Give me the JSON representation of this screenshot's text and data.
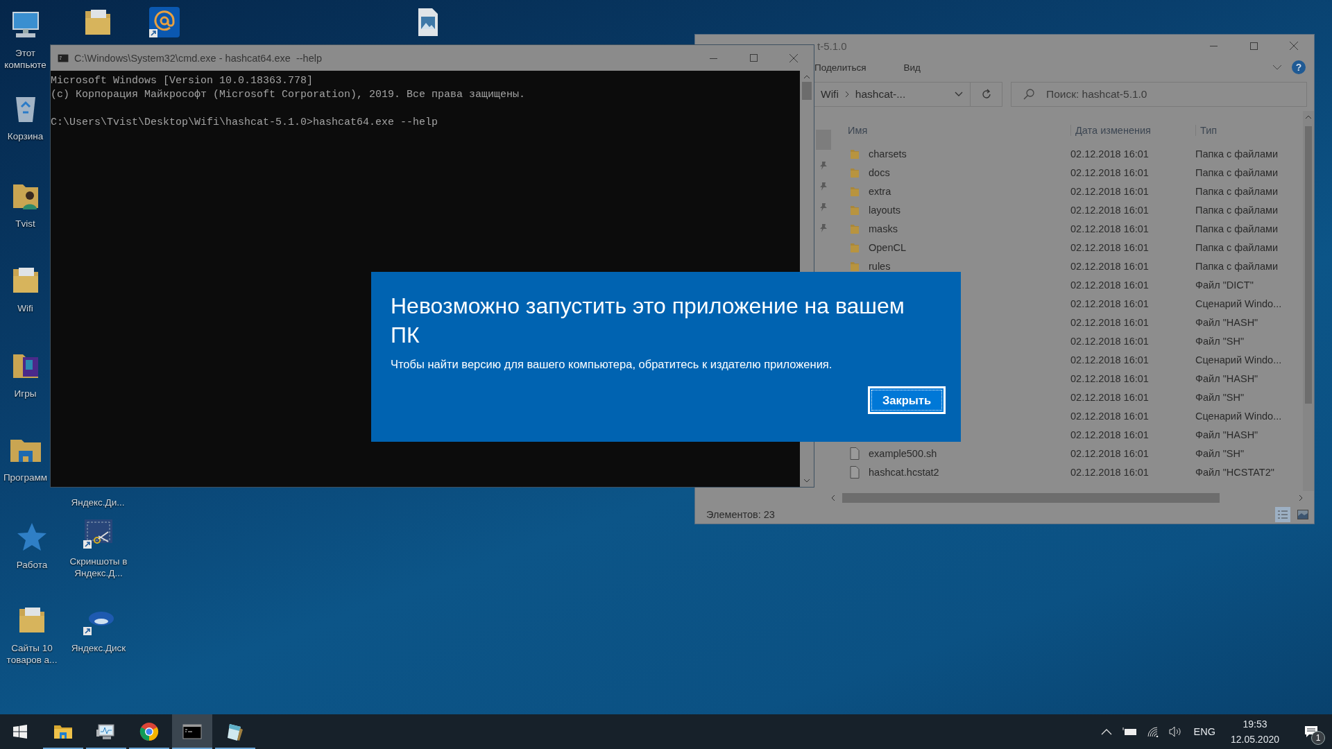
{
  "desktop_icons": [
    {
      "label": "Этот компьюте",
      "kind": "computer"
    },
    {
      "label": "Корзина",
      "kind": "recycle-bin"
    },
    {
      "label": "Tvist",
      "kind": "user-folder"
    },
    {
      "label": "Wifi",
      "kind": "folder"
    },
    {
      "label": "Игры",
      "kind": "games"
    },
    {
      "label": "Программ",
      "kind": "programs"
    },
    {
      "label": "Работа",
      "kind": "star"
    },
    {
      "label": "Сайты 10 товаров а...",
      "kind": "folder"
    },
    {
      "kind": "folder"
    },
    {
      "label": "Яндекс.Ди..."
    },
    {
      "label": "Скриншоты в Яндекс.Д...",
      "kind": "screenshots"
    },
    {
      "label": "Яндекс.Диск",
      "kind": "disk"
    },
    {
      "kind": "mail"
    },
    {
      "kind": "image"
    }
  ],
  "cmd_window": {
    "title": "C:\\Windows\\System32\\cmd.exe - hashcat64.exe  --help",
    "banner": [
      "Microsoft Windows [Version 10.0.18363.778]",
      "(c) Корпорация Майкрософт (Microsoft Corporation), 2019. Все права защищены."
    ],
    "prompt": "C:\\Users\\Tvist\\Desktop\\Wifi\\hashcat-5.1.0>hashcat64.exe --help"
  },
  "explorer": {
    "title": "t-5.1.0",
    "ribbon_tabs": [
      "Поделиться",
      "Вид"
    ],
    "help_button": "?",
    "breadcrumb": [
      "Wifi",
      "hashcat-..."
    ],
    "search": {
      "placeholder": "Поиск: hashcat-5.1.0"
    },
    "columns": [
      "Имя",
      "Дата изменения",
      "Тип"
    ],
    "rows": [
      {
        "name": "charsets",
        "kind": "folder",
        "date": "02.12.2018 16:01",
        "type": "Папка с файлами"
      },
      {
        "name": "docs",
        "kind": "folder",
        "date": "02.12.2018 16:01",
        "type": "Папка с файлами"
      },
      {
        "name": "extra",
        "kind": "folder",
        "date": "02.12.2018 16:01",
        "type": "Папка с файлами"
      },
      {
        "name": "layouts",
        "kind": "folder",
        "date": "02.12.2018 16:01",
        "type": "Папка с файлами"
      },
      {
        "name": "masks",
        "kind": "folder",
        "date": "02.12.2018 16:01",
        "type": "Папка с файлами"
      },
      {
        "name": "OpenCL",
        "kind": "folder",
        "date": "02.12.2018 16:01",
        "type": "Папка с файлами"
      },
      {
        "name": "rules",
        "kind": "folder",
        "date": "02.12.2018 16:01",
        "type": "Папка с файлами"
      },
      {
        "date": "02.12.2018 16:01",
        "type": "Файл \"DICT\""
      },
      {
        "date": "02.12.2018 16:01",
        "type": "Сценарий Windo..."
      },
      {
        "date": "02.12.2018 16:01",
        "type": "Файл \"HASH\""
      },
      {
        "date": "02.12.2018 16:01",
        "type": "Файл \"SH\""
      },
      {
        "date": "02.12.2018 16:01",
        "type": "Сценарий Windo..."
      },
      {
        "date": "02.12.2018 16:01",
        "type": "Файл \"HASH\""
      },
      {
        "date": "02.12.2018 16:01",
        "type": "Файл \"SH\""
      },
      {
        "date": "02.12.2018 16:01",
        "type": "Сценарий Windo..."
      },
      {
        "date": "02.12.2018 16:01",
        "type": "Файл \"HASH\""
      },
      {
        "name": "example500.sh",
        "kind": "file",
        "date": "02.12.2018 16:01",
        "type": "Файл \"SH\""
      },
      {
        "name": "hashcat.hcstat2",
        "kind": "file",
        "date": "02.12.2018 16:01",
        "type": "Файл \"HCSTAT2\""
      }
    ],
    "status": "Элементов: 23"
  },
  "dialog": {
    "title": "Невозможно запустить это приложение на вашем ПК",
    "message": "Чтобы найти версию для вашего компьютера, обратитесь к издателю приложения.",
    "button": "Закрыть"
  },
  "taskbar": {
    "apps": [
      {
        "kind": "explorer",
        "running": true,
        "selected": false
      },
      {
        "kind": "monitor",
        "running": true,
        "selected": false
      },
      {
        "kind": "chrome",
        "running": true,
        "selected": false
      },
      {
        "kind": "cmd",
        "running": true,
        "selected": true
      },
      {
        "kind": "notepad",
        "running": true,
        "selected": false
      }
    ],
    "language": "ENG",
    "time": "19:53",
    "date": "12.05.2020",
    "notifications": "1"
  }
}
